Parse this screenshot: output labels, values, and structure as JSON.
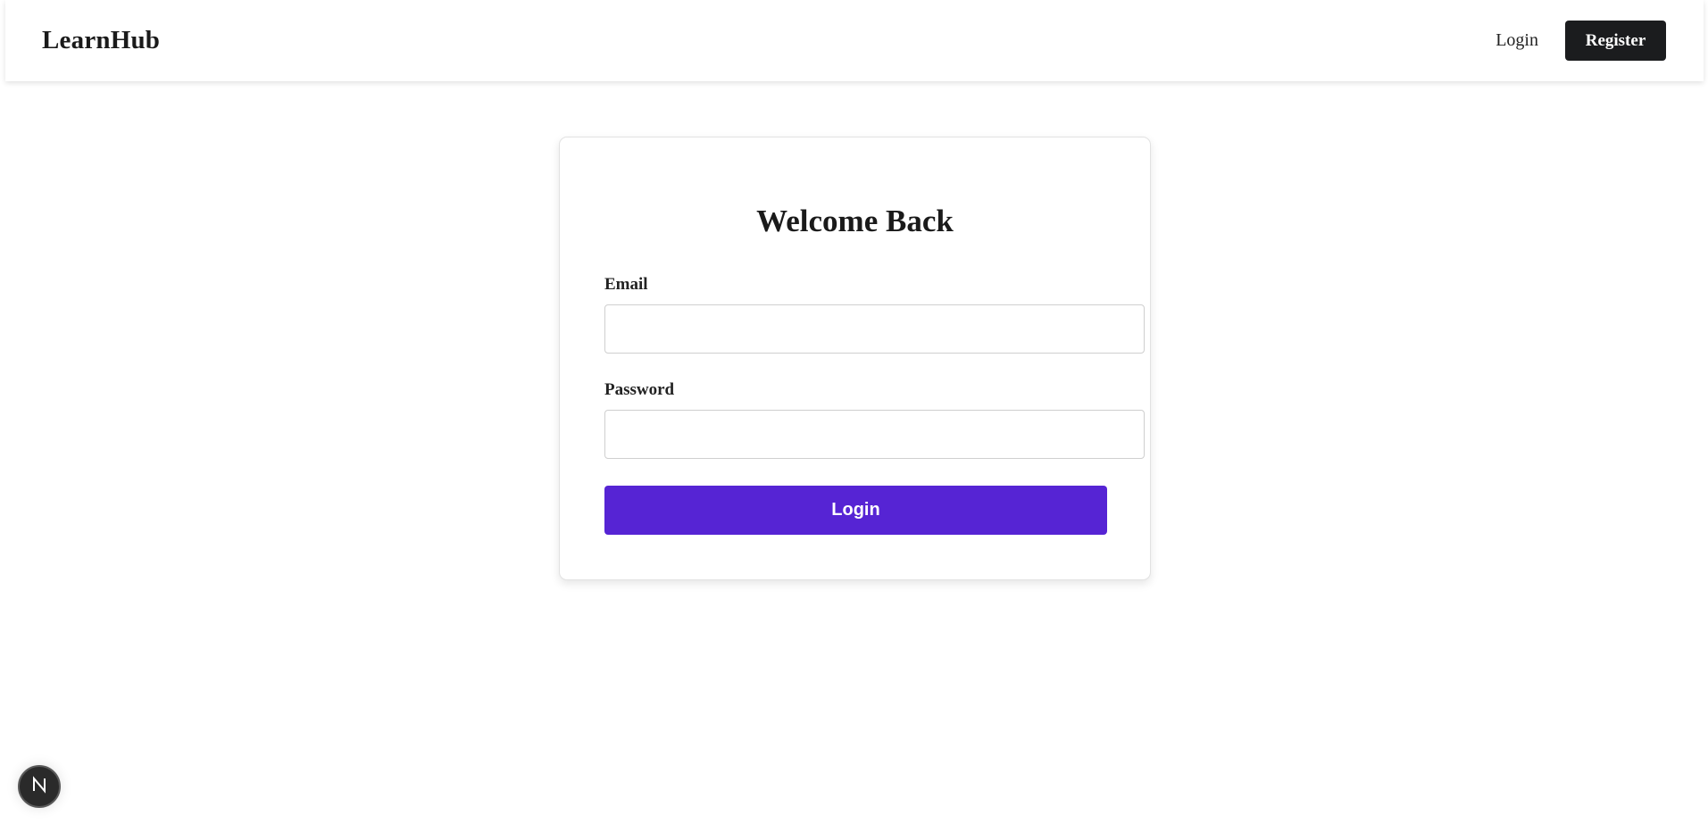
{
  "header": {
    "brand": "LearnHub",
    "login_link": "Login",
    "register_button": "Register"
  },
  "login_form": {
    "title": "Welcome Back",
    "email_label": "Email",
    "email_value": "",
    "password_label": "Password",
    "password_value": "",
    "submit_label": "Login"
  },
  "colors": {
    "primary": "#5624d4",
    "register_bg": "#1b1c1e",
    "text": "#1a1a1a"
  },
  "dev_badge": {
    "icon": "nextjs-n-icon"
  }
}
